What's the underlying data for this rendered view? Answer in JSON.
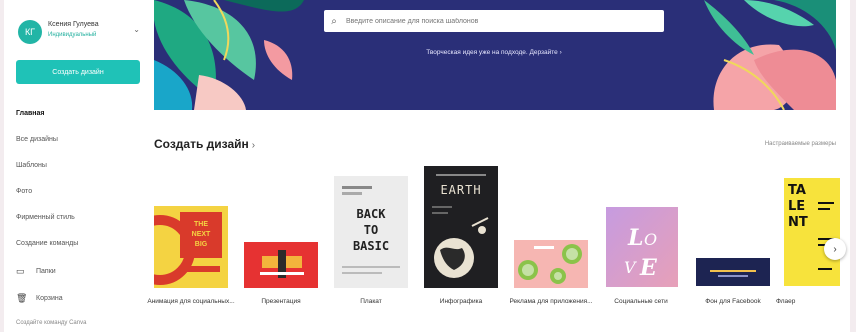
{
  "account": {
    "initials": "КГ",
    "name": "Ксения Гулуева",
    "subtitle": "Индивидуальный"
  },
  "sidebar": {
    "create_label": "Создать дизайн",
    "items": [
      {
        "label": "Главная",
        "active": true
      },
      {
        "label": "Все дизайны"
      },
      {
        "label": "Шаблоны"
      },
      {
        "label": "Фото"
      },
      {
        "label": "Фирменный стиль"
      },
      {
        "label": "Создание команды"
      }
    ],
    "folders_label": "Папки",
    "trash_label": "Корзина",
    "footer": "Создайте команду Canva"
  },
  "banner": {
    "search_placeholder": "Введите описание для поиска шаблонов",
    "link_text": "Творческая идея уже на подходе. Дерзайте ›"
  },
  "section": {
    "title": "Создать дизайн",
    "arrow": "›",
    "link": "Настраиваемые размеры"
  },
  "cards": [
    {
      "label": "Анимация для социальных..."
    },
    {
      "label": "Презентация"
    },
    {
      "label": "Плакат",
      "art": "BACK TO BASIC"
    },
    {
      "label": "Инфографика",
      "art": "EARTH"
    },
    {
      "label": "Реклама для приложения..."
    },
    {
      "label": "Социальные сети",
      "art": "LOVE"
    },
    {
      "label": "Фон для Facebook"
    },
    {
      "label": "Флаер",
      "art": "TA LE NT"
    }
  ],
  "icons": {
    "search": "search-icon",
    "folder": "folder-icon",
    "trash": "trash-icon",
    "next": "chevron-right-icon"
  }
}
